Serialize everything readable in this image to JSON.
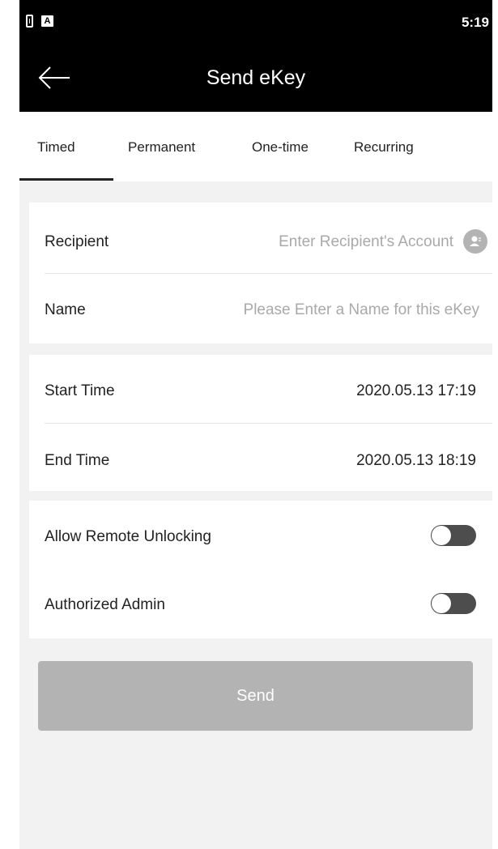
{
  "status_bar": {
    "time": "5:19",
    "icons": [
      "phone-icon",
      "a-icon"
    ],
    "a_icon_text": "A"
  },
  "header": {
    "title": "Send eKey",
    "back_icon": "back-arrow-icon"
  },
  "tabs": [
    {
      "label": "Timed",
      "selected": true
    },
    {
      "label": "Permanent",
      "selected": false
    },
    {
      "label": "One-time",
      "selected": false
    },
    {
      "label": "Recurring",
      "selected": false
    }
  ],
  "recipient": {
    "label": "Recipient",
    "placeholder": "Enter Recipient's Account",
    "icon": "contact-icon"
  },
  "name": {
    "label": "Name",
    "placeholder": "Please Enter a Name for this eKey"
  },
  "start_time": {
    "label": "Start Time",
    "value": "2020.05.13 17:19"
  },
  "end_time": {
    "label": "End Time",
    "value": "2020.05.13 18:19"
  },
  "allow_remote_unlocking": {
    "label": "Allow Remote Unlocking",
    "on": false
  },
  "authorized_admin": {
    "label": "Authorized Admin",
    "on": false
  },
  "send_button": {
    "label": "Send",
    "enabled": false
  },
  "colors": {
    "header_bg": "#000000",
    "page_bg": "#f2f2f2",
    "placeholder": "#a9a9a9",
    "button_disabled": "#b3b3b3",
    "toggle_off": "#4d4d4d"
  }
}
